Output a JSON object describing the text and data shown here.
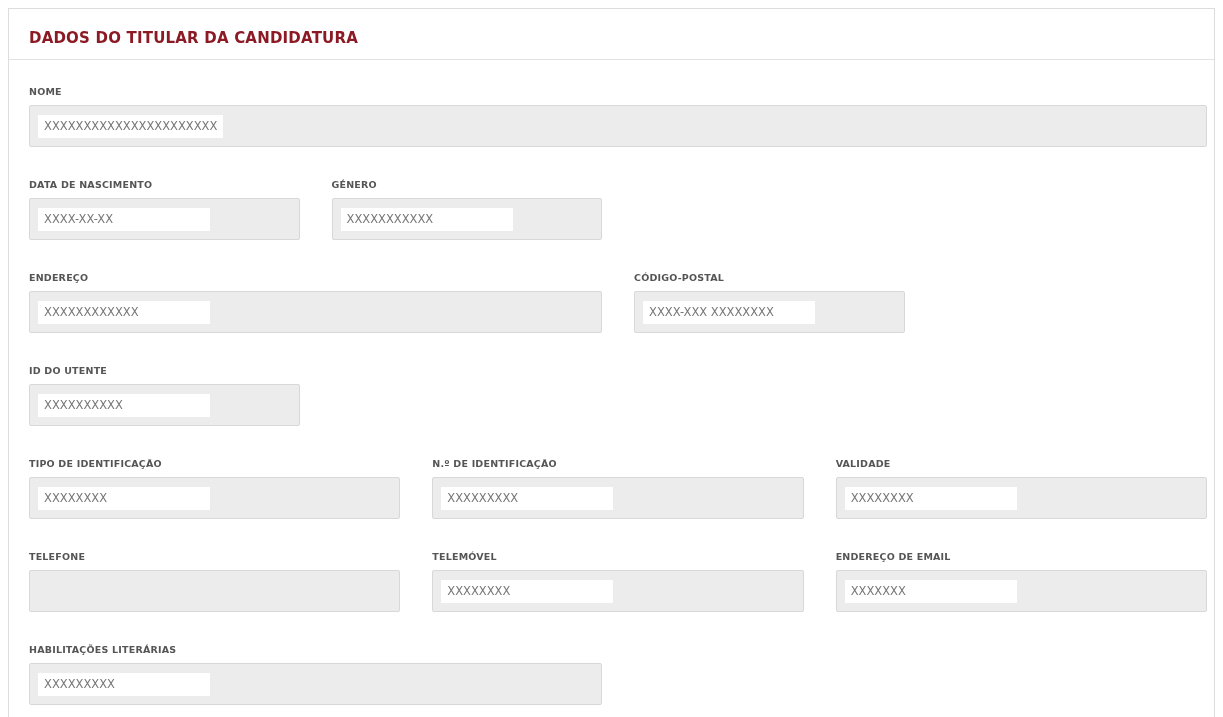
{
  "panel": {
    "title": "DADOS DO TITULAR DA CANDIDATURA"
  },
  "rows": [
    [
      {
        "label": "NOME",
        "value": "XXXXXXXXXXXXXXXXXXXXXX"
      }
    ],
    [
      {
        "label": "DATA DE NASCIMENTO",
        "value": "XXXX-XX-XX"
      },
      {
        "label": "GÉNERO",
        "value": "XXXXXXXXXXX"
      }
    ],
    [
      {
        "label": "ENDEREÇO",
        "value": "XXXXXXXXXXXX"
      },
      {
        "label": "CÓDIGO-POSTAL",
        "value": "XXXX-XXX XXXXXXXX"
      }
    ],
    [
      {
        "label": "ID DO UTENTE",
        "value": "XXXXXXXXXX"
      }
    ],
    [
      {
        "label": "TIPO DE IDENTIFICAÇÃO",
        "value": "XXXXXXXX"
      },
      {
        "label": "N.º DE IDENTIFICAÇÃO",
        "value": "XXXXXXXXX"
      },
      {
        "label": "VALIDADE",
        "value": "XXXXXXXX"
      }
    ],
    [
      {
        "label": "TELEFONE"
      },
      {
        "label": "TELEMÓVEL",
        "value": "XXXXXXXX"
      },
      {
        "label": "ENDEREÇO DE EMAIL",
        "value": "XXXXXXX"
      }
    ],
    [
      {
        "label": "HABILITAÇÕES LITERÁRIAS",
        "value": "XXXXXXXXX"
      }
    ]
  ]
}
